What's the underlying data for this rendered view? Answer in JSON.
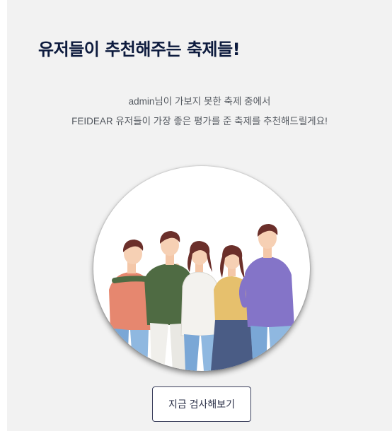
{
  "header": {
    "title": "유저들이 추천해주는 축제들!"
  },
  "description": {
    "line1": "admin님이 가보지 못한 축제 중에서",
    "line2": "FEIDEAR 유저들이 가장 좋은 평가를 준 축제를 추천해드릴게요!"
  },
  "illustration": {
    "name": "group-of-friends-illustration"
  },
  "cta": {
    "label": "지금 검사해보기"
  },
  "colors": {
    "title": "#0d1b3e",
    "panel_background": "#f2f2f2",
    "button_border": "#3a3f5c"
  }
}
